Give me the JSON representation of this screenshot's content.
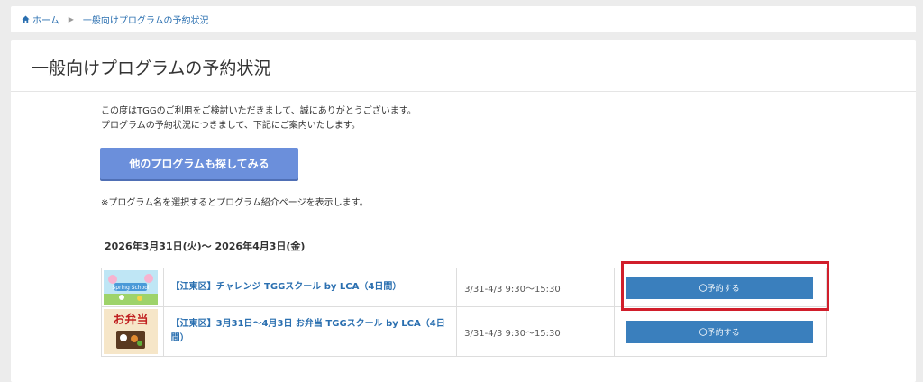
{
  "breadcrumb": {
    "home": "ホーム",
    "current": "一般向けプログラムの予約状況"
  },
  "page": {
    "title": "一般向けプログラムの予約状況",
    "intro_line1": "この度はTGGのご利用をご検討いただきまして、誠にありがとうございます。",
    "intro_line2": "プログラムの予約状況につきまして、下記にご案内いたします。",
    "search_button": "他のプログラムも探してみる",
    "note": "※プログラム名を選択するとプログラム紹介ページを表示します。",
    "date_range": "2026年3月31日(火)～ 2026年4月3日(金)"
  },
  "programs": [
    {
      "name": "【江東区】チャレンジ TGGスクール by LCA（4日間）",
      "time": "3/31-4/3 9:30～15:30",
      "button": "〇予約する",
      "thumb_icon": "spring-school-thumbnail",
      "thumb_text": "Spring School"
    },
    {
      "name": "【江東区】3月31日～4月3日 お弁当 TGGスクール by LCA（4日間）",
      "time": "3/31-4/3 9:30～15:30",
      "button": "〇予約する",
      "thumb_icon": "bento-thumbnail",
      "thumb_text": "お弁当"
    }
  ],
  "colors": {
    "link": "#2a6fb0",
    "search_button": "#6b8fdb",
    "reserve_button": "#3a7fbd",
    "highlight": "#d11e2b"
  }
}
